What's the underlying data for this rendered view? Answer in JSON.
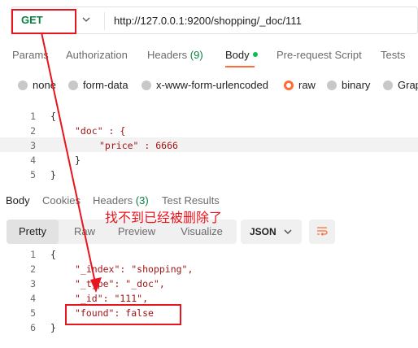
{
  "request": {
    "method": "GET",
    "url": "http://127.0.0.1:9200/shopping/_doc/111"
  },
  "request_tabs": [
    {
      "label": "Params"
    },
    {
      "label": "Authorization"
    },
    {
      "label": "Headers",
      "count": "(9)"
    },
    {
      "label": "Body",
      "active": true
    },
    {
      "label": "Pre-request Script"
    },
    {
      "label": "Tests"
    }
  ],
  "body_types": [
    {
      "label": "none"
    },
    {
      "label": "form-data"
    },
    {
      "label": "x-www-form-urlencoded"
    },
    {
      "label": "raw",
      "selected": true
    },
    {
      "label": "binary"
    },
    {
      "label": "Grap"
    }
  ],
  "request_body": {
    "line_numbers": [
      "1",
      "2",
      "3",
      "4",
      "5"
    ],
    "lines": [
      "{",
      "\"doc\" : {",
      "\"price\" : 6666",
      "}",
      "}"
    ]
  },
  "response_tabs": [
    {
      "label": "Body",
      "active": true
    },
    {
      "label": "Cookies"
    },
    {
      "label": "Headers",
      "count": "(3)"
    },
    {
      "label": "Test Results"
    }
  ],
  "view_modes": [
    "Pretty",
    "Raw",
    "Preview",
    "Visualize"
  ],
  "format_select": "JSON",
  "response_body": {
    "line_numbers": [
      "1",
      "2",
      "3",
      "4",
      "5",
      "6"
    ],
    "lines": [
      "{",
      "\"_index\": \"shopping\",",
      "\"_type\": \"_doc\",",
      "\"_id\": \"111\",",
      "\"found\": false",
      "}"
    ]
  },
  "annotation": {
    "text": "找不到已经被删除了",
    "color": "#e8141e"
  },
  "colors": {
    "method_green": "#0b8043",
    "accent_orange": "#ff6c37",
    "annotation_red": "#e8141e"
  }
}
